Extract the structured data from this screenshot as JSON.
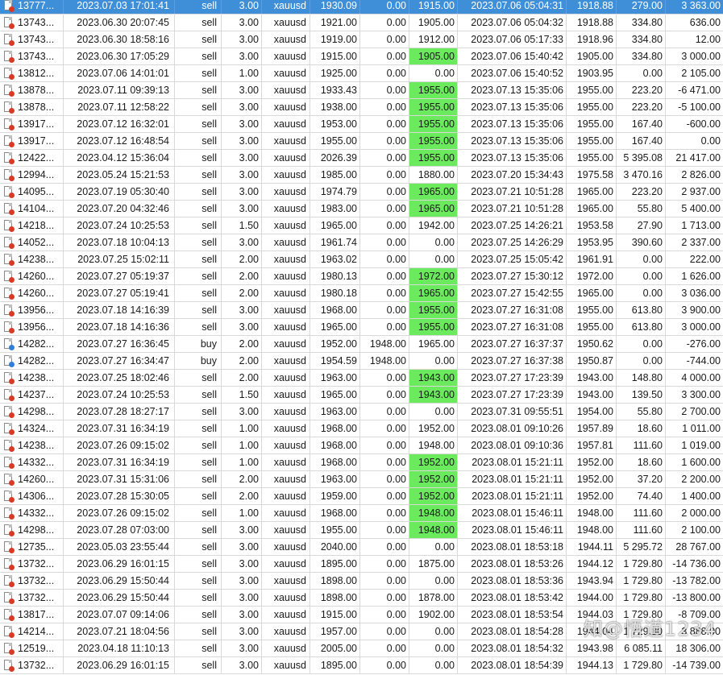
{
  "watermark": "知@悟道1234",
  "colors": {
    "selected_row": "#3f8fd8",
    "tp_hit_highlight": "#6bea5e",
    "sell_dot": "#d93a26",
    "buy_dot": "#2f7fd8"
  },
  "rows": [
    {
      "ticket": "13777...",
      "open_time": "2023.07.03 17:01:41",
      "type": "sell",
      "volume": "3.00",
      "symbol": "xauusd",
      "price": "1930.09",
      "sl": "0.00",
      "tp": "1915.00",
      "tp_hit": false,
      "close_time": "2023.07.06 05:04:31",
      "close_price": "1918.88",
      "commission": "279.00",
      "profit": "3 363.00",
      "selected": true
    },
    {
      "ticket": "13743...",
      "open_time": "2023.06.30 20:07:45",
      "type": "sell",
      "volume": "3.00",
      "symbol": "xauusd",
      "price": "1921.00",
      "sl": "0.00",
      "tp": "1905.00",
      "tp_hit": false,
      "close_time": "2023.07.06 05:04:32",
      "close_price": "1918.88",
      "commission": "334.80",
      "profit": "636.00"
    },
    {
      "ticket": "13743...",
      "open_time": "2023.06.30 18:58:16",
      "type": "sell",
      "volume": "3.00",
      "symbol": "xauusd",
      "price": "1919.00",
      "sl": "0.00",
      "tp": "1912.00",
      "tp_hit": false,
      "close_time": "2023.07.06 05:17:33",
      "close_price": "1918.96",
      "commission": "334.80",
      "profit": "12.00"
    },
    {
      "ticket": "13743...",
      "open_time": "2023.06.30 17:05:29",
      "type": "sell",
      "volume": "3.00",
      "symbol": "xauusd",
      "price": "1915.00",
      "sl": "0.00",
      "tp": "1905.00",
      "tp_hit": true,
      "close_time": "2023.07.06 15:40:42",
      "close_price": "1905.00",
      "commission": "334.80",
      "profit": "3 000.00"
    },
    {
      "ticket": "13812...",
      "open_time": "2023.07.06 14:01:01",
      "type": "sell",
      "volume": "1.00",
      "symbol": "xauusd",
      "price": "1925.00",
      "sl": "0.00",
      "tp": "0.00",
      "tp_hit": false,
      "close_time": "2023.07.06 15:40:52",
      "close_price": "1903.95",
      "commission": "0.00",
      "profit": "2 105.00"
    },
    {
      "ticket": "13878...",
      "open_time": "2023.07.11 09:39:13",
      "type": "sell",
      "volume": "3.00",
      "symbol": "xauusd",
      "price": "1933.43",
      "sl": "0.00",
      "tp": "1955.00",
      "tp_hit": true,
      "close_time": "2023.07.13 15:35:06",
      "close_price": "1955.00",
      "commission": "223.20",
      "profit": "-6 471.00"
    },
    {
      "ticket": "13878...",
      "open_time": "2023.07.11 12:58:22",
      "type": "sell",
      "volume": "3.00",
      "symbol": "xauusd",
      "price": "1938.00",
      "sl": "0.00",
      "tp": "1955.00",
      "tp_hit": true,
      "close_time": "2023.07.13 15:35:06",
      "close_price": "1955.00",
      "commission": "223.20",
      "profit": "-5 100.00"
    },
    {
      "ticket": "13917...",
      "open_time": "2023.07.12 16:32:01",
      "type": "sell",
      "volume": "3.00",
      "symbol": "xauusd",
      "price": "1953.00",
      "sl": "0.00",
      "tp": "1955.00",
      "tp_hit": true,
      "close_time": "2023.07.13 15:35:06",
      "close_price": "1955.00",
      "commission": "167.40",
      "profit": "-600.00"
    },
    {
      "ticket": "13917...",
      "open_time": "2023.07.12 16:48:54",
      "type": "sell",
      "volume": "3.00",
      "symbol": "xauusd",
      "price": "1955.00",
      "sl": "0.00",
      "tp": "1955.00",
      "tp_hit": true,
      "close_time": "2023.07.13 15:35:06",
      "close_price": "1955.00",
      "commission": "167.40",
      "profit": "0.00"
    },
    {
      "ticket": "12422...",
      "open_time": "2023.04.12 15:36:04",
      "type": "sell",
      "volume": "3.00",
      "symbol": "xauusd",
      "price": "2026.39",
      "sl": "0.00",
      "tp": "1955.00",
      "tp_hit": true,
      "close_time": "2023.07.13 15:35:06",
      "close_price": "1955.00",
      "commission": "5 395.08",
      "profit": "21 417.00"
    },
    {
      "ticket": "12994...",
      "open_time": "2023.05.24 15:21:53",
      "type": "sell",
      "volume": "3.00",
      "symbol": "xauusd",
      "price": "1985.00",
      "sl": "0.00",
      "tp": "1880.00",
      "tp_hit": false,
      "close_time": "2023.07.20 15:34:43",
      "close_price": "1975.58",
      "commission": "3 470.16",
      "profit": "2 826.00"
    },
    {
      "ticket": "14095...",
      "open_time": "2023.07.19 05:30:40",
      "type": "sell",
      "volume": "3.00",
      "symbol": "xauusd",
      "price": "1974.79",
      "sl": "0.00",
      "tp": "1965.00",
      "tp_hit": true,
      "close_time": "2023.07.21 10:51:28",
      "close_price": "1965.00",
      "commission": "223.20",
      "profit": "2 937.00"
    },
    {
      "ticket": "14104...",
      "open_time": "2023.07.20 04:32:46",
      "type": "sell",
      "volume": "3.00",
      "symbol": "xauusd",
      "price": "1983.00",
      "sl": "0.00",
      "tp": "1965.00",
      "tp_hit": true,
      "close_time": "2023.07.21 10:51:28",
      "close_price": "1965.00",
      "commission": "55.80",
      "profit": "5 400.00"
    },
    {
      "ticket": "14218...",
      "open_time": "2023.07.24 10:25:53",
      "type": "sell",
      "volume": "1.50",
      "symbol": "xauusd",
      "price": "1965.00",
      "sl": "0.00",
      "tp": "1942.00",
      "tp_hit": false,
      "close_time": "2023.07.25 14:26:21",
      "close_price": "1953.58",
      "commission": "27.90",
      "profit": "1 713.00"
    },
    {
      "ticket": "14052...",
      "open_time": "2023.07.18 10:04:13",
      "type": "sell",
      "volume": "3.00",
      "symbol": "xauusd",
      "price": "1961.74",
      "sl": "0.00",
      "tp": "0.00",
      "tp_hit": false,
      "close_time": "2023.07.25 14:26:29",
      "close_price": "1953.95",
      "commission": "390.60",
      "profit": "2 337.00"
    },
    {
      "ticket": "14238...",
      "open_time": "2023.07.25 15:02:11",
      "type": "sell",
      "volume": "2.00",
      "symbol": "xauusd",
      "price": "1963.02",
      "sl": "0.00",
      "tp": "0.00",
      "tp_hit": false,
      "close_time": "2023.07.25 15:05:42",
      "close_price": "1961.91",
      "commission": "0.00",
      "profit": "222.00"
    },
    {
      "ticket": "14260...",
      "open_time": "2023.07.27 05:19:37",
      "type": "sell",
      "volume": "2.00",
      "symbol": "xauusd",
      "price": "1980.13",
      "sl": "0.00",
      "tp": "1972.00",
      "tp_hit": true,
      "close_time": "2023.07.27 15:30:12",
      "close_price": "1972.00",
      "commission": "0.00",
      "profit": "1 626.00"
    },
    {
      "ticket": "14260...",
      "open_time": "2023.07.27 05:19:41",
      "type": "sell",
      "volume": "2.00",
      "symbol": "xauusd",
      "price": "1980.18",
      "sl": "0.00",
      "tp": "1965.00",
      "tp_hit": true,
      "close_time": "2023.07.27 15:42:55",
      "close_price": "1965.00",
      "commission": "0.00",
      "profit": "3 036.00"
    },
    {
      "ticket": "13956...",
      "open_time": "2023.07.18 14:16:39",
      "type": "sell",
      "volume": "3.00",
      "symbol": "xauusd",
      "price": "1968.00",
      "sl": "0.00",
      "tp": "1955.00",
      "tp_hit": true,
      "close_time": "2023.07.27 16:31:08",
      "close_price": "1955.00",
      "commission": "613.80",
      "profit": "3 900.00"
    },
    {
      "ticket": "13956...",
      "open_time": "2023.07.18 14:16:36",
      "type": "sell",
      "volume": "3.00",
      "symbol": "xauusd",
      "price": "1965.00",
      "sl": "0.00",
      "tp": "1955.00",
      "tp_hit": true,
      "close_time": "2023.07.27 16:31:08",
      "close_price": "1955.00",
      "commission": "613.80",
      "profit": "3 000.00"
    },
    {
      "ticket": "14282...",
      "open_time": "2023.07.27 16:36:45",
      "type": "buy",
      "volume": "2.00",
      "symbol": "xauusd",
      "price": "1952.00",
      "sl": "1948.00",
      "tp": "1965.00",
      "tp_hit": false,
      "close_time": "2023.07.27 16:37:37",
      "close_price": "1950.62",
      "commission": "0.00",
      "profit": "-276.00"
    },
    {
      "ticket": "14282...",
      "open_time": "2023.07.27 16:34:47",
      "type": "buy",
      "volume": "2.00",
      "symbol": "xauusd",
      "price": "1954.59",
      "sl": "1948.00",
      "tp": "0.00",
      "tp_hit": false,
      "close_time": "2023.07.27 16:37:38",
      "close_price": "1950.87",
      "commission": "0.00",
      "profit": "-744.00"
    },
    {
      "ticket": "14238...",
      "open_time": "2023.07.25 18:02:46",
      "type": "sell",
      "volume": "2.00",
      "symbol": "xauusd",
      "price": "1963.00",
      "sl": "0.00",
      "tp": "1943.00",
      "tp_hit": true,
      "close_time": "2023.07.27 17:23:39",
      "close_price": "1943.00",
      "commission": "148.80",
      "profit": "4 000.00"
    },
    {
      "ticket": "14237...",
      "open_time": "2023.07.24 10:25:53",
      "type": "sell",
      "volume": "1.50",
      "symbol": "xauusd",
      "price": "1965.00",
      "sl": "0.00",
      "tp": "1943.00",
      "tp_hit": true,
      "close_time": "2023.07.27 17:23:39",
      "close_price": "1943.00",
      "commission": "139.50",
      "profit": "3 300.00"
    },
    {
      "ticket": "14298...",
      "open_time": "2023.07.28 18:27:17",
      "type": "sell",
      "volume": "3.00",
      "symbol": "xauusd",
      "price": "1963.00",
      "sl": "0.00",
      "tp": "0.00",
      "tp_hit": false,
      "close_time": "2023.07.31 09:55:51",
      "close_price": "1954.00",
      "commission": "55.80",
      "profit": "2 700.00"
    },
    {
      "ticket": "14324...",
      "open_time": "2023.07.31 16:34:19",
      "type": "sell",
      "volume": "1.00",
      "symbol": "xauusd",
      "price": "1968.00",
      "sl": "0.00",
      "tp": "1952.00",
      "tp_hit": false,
      "close_time": "2023.08.01 09:10:26",
      "close_price": "1957.89",
      "commission": "18.60",
      "profit": "1 011.00"
    },
    {
      "ticket": "14238...",
      "open_time": "2023.07.26 09:15:02",
      "type": "sell",
      "volume": "1.00",
      "symbol": "xauusd",
      "price": "1968.00",
      "sl": "0.00",
      "tp": "1948.00",
      "tp_hit": false,
      "close_time": "2023.08.01 09:10:36",
      "close_price": "1957.81",
      "commission": "111.60",
      "profit": "1 019.00"
    },
    {
      "ticket": "14332...",
      "open_time": "2023.07.31 16:34:19",
      "type": "sell",
      "volume": "1.00",
      "symbol": "xauusd",
      "price": "1968.00",
      "sl": "0.00",
      "tp": "1952.00",
      "tp_hit": true,
      "close_time": "2023.08.01 15:21:11",
      "close_price": "1952.00",
      "commission": "18.60",
      "profit": "1 600.00"
    },
    {
      "ticket": "14260...",
      "open_time": "2023.07.31 15:31:06",
      "type": "sell",
      "volume": "2.00",
      "symbol": "xauusd",
      "price": "1963.00",
      "sl": "0.00",
      "tp": "1952.00",
      "tp_hit": true,
      "close_time": "2023.08.01 15:21:11",
      "close_price": "1952.00",
      "commission": "37.20",
      "profit": "2 200.00"
    },
    {
      "ticket": "14306...",
      "open_time": "2023.07.28 15:30:05",
      "type": "sell",
      "volume": "2.00",
      "symbol": "xauusd",
      "price": "1959.00",
      "sl": "0.00",
      "tp": "1952.00",
      "tp_hit": true,
      "close_time": "2023.08.01 15:21:11",
      "close_price": "1952.00",
      "commission": "74.40",
      "profit": "1 400.00"
    },
    {
      "ticket": "14332...",
      "open_time": "2023.07.26 09:15:02",
      "type": "sell",
      "volume": "1.00",
      "symbol": "xauusd",
      "price": "1968.00",
      "sl": "0.00",
      "tp": "1948.00",
      "tp_hit": true,
      "close_time": "2023.08.01 15:46:11",
      "close_price": "1948.00",
      "commission": "111.60",
      "profit": "2 000.00"
    },
    {
      "ticket": "14298...",
      "open_time": "2023.07.28 07:03:00",
      "type": "sell",
      "volume": "3.00",
      "symbol": "xauusd",
      "price": "1955.00",
      "sl": "0.00",
      "tp": "1948.00",
      "tp_hit": true,
      "close_time": "2023.08.01 15:46:11",
      "close_price": "1948.00",
      "commission": "111.60",
      "profit": "2 100.00"
    },
    {
      "ticket": "12735...",
      "open_time": "2023.05.03 23:55:44",
      "type": "sell",
      "volume": "3.00",
      "symbol": "xauusd",
      "price": "2040.00",
      "sl": "0.00",
      "tp": "0.00",
      "tp_hit": false,
      "close_time": "2023.08.01 18:53:18",
      "close_price": "1944.11",
      "commission": "5 295.72",
      "profit": "28 767.00"
    },
    {
      "ticket": "13732...",
      "open_time": "2023.06.29 16:01:15",
      "type": "sell",
      "volume": "3.00",
      "symbol": "xauusd",
      "price": "1895.00",
      "sl": "0.00",
      "tp": "1875.00",
      "tp_hit": false,
      "close_time": "2023.08.01 18:53:26",
      "close_price": "1944.12",
      "commission": "1 729.80",
      "profit": "-14 736.00"
    },
    {
      "ticket": "13732...",
      "open_time": "2023.06.29 15:50:44",
      "type": "sell",
      "volume": "3.00",
      "symbol": "xauusd",
      "price": "1898.00",
      "sl": "0.00",
      "tp": "0.00",
      "tp_hit": false,
      "close_time": "2023.08.01 18:53:36",
      "close_price": "1943.94",
      "commission": "1 729.80",
      "profit": "-13 782.00"
    },
    {
      "ticket": "13732...",
      "open_time": "2023.06.29 15:50:44",
      "type": "sell",
      "volume": "3.00",
      "symbol": "xauusd",
      "price": "1898.00",
      "sl": "0.00",
      "tp": "1878.00",
      "tp_hit": false,
      "close_time": "2023.08.01 18:53:42",
      "close_price": "1944.00",
      "commission": "1 729.80",
      "profit": "-13 800.00"
    },
    {
      "ticket": "13817...",
      "open_time": "2023.07.07 09:14:06",
      "type": "sell",
      "volume": "3.00",
      "symbol": "xauusd",
      "price": "1915.00",
      "sl": "0.00",
      "tp": "1902.00",
      "tp_hit": false,
      "close_time": "2023.08.01 18:53:54",
      "close_price": "1944.03",
      "commission": "1 729.80",
      "profit": "-8 709.00"
    },
    {
      "ticket": "14214...",
      "open_time": "2023.07.21 18:04:56",
      "type": "sell",
      "volume": "3.00",
      "symbol": "xauusd",
      "price": "1957.00",
      "sl": "0.00",
      "tp": "0.00",
      "tp_hit": false,
      "close_time": "2023.08.01 18:54:28",
      "close_price": "1944.04",
      "commission": "1 729.80",
      "profit": "3 888.00"
    },
    {
      "ticket": "12519...",
      "open_time": "2023.04.18 11:10:13",
      "type": "sell",
      "volume": "3.00",
      "symbol": "xauusd",
      "price": "2005.00",
      "sl": "0.00",
      "tp": "0.00",
      "tp_hit": false,
      "close_time": "2023.08.01 18:54:32",
      "close_price": "1943.98",
      "commission": "6 085.11",
      "profit": "18 306.00"
    },
    {
      "ticket": "13732...",
      "open_time": "2023.06.29 16:01:15",
      "type": "sell",
      "volume": "3.00",
      "symbol": "xauusd",
      "price": "1895.00",
      "sl": "0.00",
      "tp": "0.00",
      "tp_hit": false,
      "close_time": "2023.08.01 18:54:39",
      "close_price": "1944.13",
      "commission": "1 729.80",
      "profit": "-14 739.00"
    }
  ]
}
